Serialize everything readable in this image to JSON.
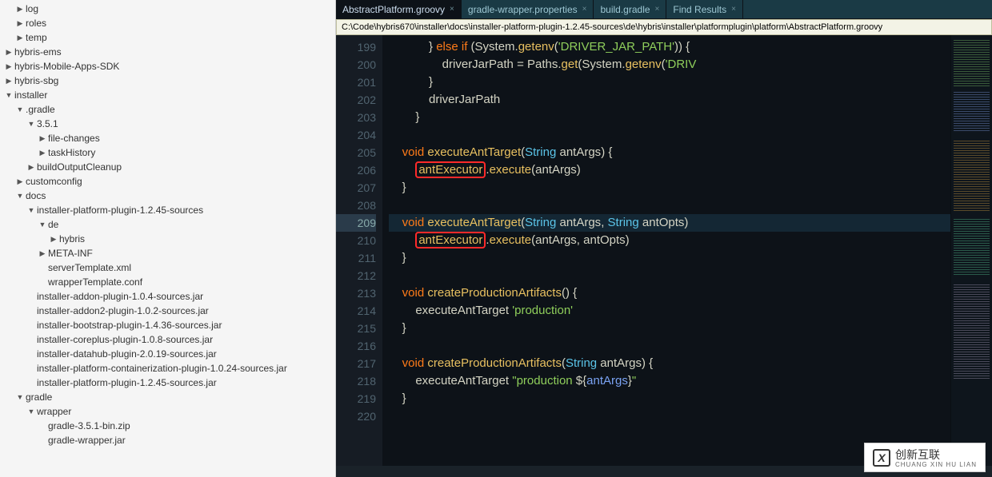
{
  "tree": [
    {
      "label": "log",
      "tw": "▶",
      "ind": 1
    },
    {
      "label": "roles",
      "tw": "▶",
      "ind": 1
    },
    {
      "label": "temp",
      "tw": "▶",
      "ind": 1
    },
    {
      "label": "hybris-ems",
      "tw": "▶",
      "ind": 0
    },
    {
      "label": "hybris-Mobile-Apps-SDK",
      "tw": "▶",
      "ind": 0
    },
    {
      "label": "hybris-sbg",
      "tw": "▶",
      "ind": 0
    },
    {
      "label": "installer",
      "tw": "▼",
      "ind": 0
    },
    {
      "label": ".gradle",
      "tw": "▼",
      "ind": 1
    },
    {
      "label": "3.5.1",
      "tw": "▼",
      "ind": 2
    },
    {
      "label": "file-changes",
      "tw": "▶",
      "ind": 3
    },
    {
      "label": "taskHistory",
      "tw": "▶",
      "ind": 3
    },
    {
      "label": "buildOutputCleanup",
      "tw": "▶",
      "ind": 2
    },
    {
      "label": "customconfig",
      "tw": "▶",
      "ind": 1
    },
    {
      "label": "docs",
      "tw": "▼",
      "ind": 1
    },
    {
      "label": "installer-platform-plugin-1.2.45-sources",
      "tw": "▼",
      "ind": 2
    },
    {
      "label": "de",
      "tw": "▼",
      "ind": 3
    },
    {
      "label": "hybris",
      "tw": "▶",
      "ind": 4
    },
    {
      "label": "META-INF",
      "tw": "▶",
      "ind": 3
    },
    {
      "label": "serverTemplate.xml",
      "tw": "",
      "ind": 3
    },
    {
      "label": "wrapperTemplate.conf",
      "tw": "",
      "ind": 3
    },
    {
      "label": "installer-addon-plugin-1.0.4-sources.jar",
      "tw": "",
      "ind": 2
    },
    {
      "label": "installer-addon2-plugin-1.0.2-sources.jar",
      "tw": "",
      "ind": 2
    },
    {
      "label": "installer-bootstrap-plugin-1.4.36-sources.jar",
      "tw": "",
      "ind": 2
    },
    {
      "label": "installer-coreplus-plugin-1.0.8-sources.jar",
      "tw": "",
      "ind": 2
    },
    {
      "label": "installer-datahub-plugin-2.0.19-sources.jar",
      "tw": "",
      "ind": 2
    },
    {
      "label": "installer-platform-containerization-plugin-1.0.24-sources.jar",
      "tw": "",
      "ind": 2
    },
    {
      "label": "installer-platform-plugin-1.2.45-sources.jar",
      "tw": "",
      "ind": 2
    },
    {
      "label": "gradle",
      "tw": "▼",
      "ind": 1
    },
    {
      "label": "wrapper",
      "tw": "▼",
      "ind": 2
    },
    {
      "label": "gradle-3.5.1-bin.zip",
      "tw": "",
      "ind": 3
    },
    {
      "label": "gradle-wrapper.jar",
      "tw": "",
      "ind": 3
    }
  ],
  "tabs": [
    {
      "label": "AbstractPlatform.groovy",
      "active": true
    },
    {
      "label": "gradle-wrapper.properties",
      "active": false
    },
    {
      "label": "build.gradle",
      "active": false
    },
    {
      "label": "Find Results",
      "active": false
    }
  ],
  "close_glyph": "×",
  "path": "C:\\Code\\hybris670\\installer\\docs\\installer-platform-plugin-1.2.45-sources\\de\\hybris\\installer\\platformplugin\\platform\\AbstractPlatform.groovy",
  "line_start": 199,
  "line_end": 220,
  "highlight_line": 209,
  "code": {
    "199": {
      "segs": [
        [
          "            } ",
          "pun"
        ],
        [
          "else if",
          "kw"
        ],
        [
          " (System.",
          "id"
        ],
        [
          "getenv",
          "fn"
        ],
        [
          "(",
          "pun"
        ],
        [
          "'DRIVER_JAR_PATH'",
          "str"
        ],
        [
          ")) {",
          "pun"
        ]
      ]
    },
    "200": {
      "segs": [
        [
          "                driverJarPath ",
          "id"
        ],
        [
          "=",
          "pun"
        ],
        [
          " Paths.",
          "id"
        ],
        [
          "get",
          "fn"
        ],
        [
          "(System.",
          "id"
        ],
        [
          "getenv",
          "fn"
        ],
        [
          "(",
          "pun"
        ],
        [
          "'DRIV",
          "str"
        ]
      ]
    },
    "201": {
      "segs": [
        [
          "            }",
          "pun"
        ]
      ]
    },
    "202": {
      "segs": [
        [
          "            driverJarPath",
          "id"
        ]
      ]
    },
    "203": {
      "segs": [
        [
          "        }",
          "pun"
        ]
      ]
    },
    "204": {
      "segs": [
        [
          "",
          ""
        ]
      ]
    },
    "205": {
      "segs": [
        [
          "    ",
          "pun"
        ],
        [
          "void",
          "kw"
        ],
        [
          " ",
          "pun"
        ],
        [
          "executeAntTarget",
          "fn"
        ],
        [
          "(",
          "pun"
        ],
        [
          "String",
          "type"
        ],
        [
          " antArgs",
          "id"
        ],
        [
          ") {",
          "pun"
        ]
      ]
    },
    "206": {
      "segs": [
        [
          "        ",
          "pun"
        ],
        [
          "antExecutor",
          "box"
        ],
        [
          ".",
          "pun"
        ],
        [
          "execute",
          "fn"
        ],
        [
          "(antArgs)",
          "id"
        ]
      ]
    },
    "207": {
      "segs": [
        [
          "    }",
          "pun"
        ]
      ]
    },
    "208": {
      "segs": [
        [
          "",
          ""
        ]
      ]
    },
    "209": {
      "segs": [
        [
          "    ",
          "pun"
        ],
        [
          "void",
          "kw"
        ],
        [
          " ",
          "pun"
        ],
        [
          "executeAntTarget",
          "fn"
        ],
        [
          "(",
          "pun"
        ],
        [
          "String",
          "type"
        ],
        [
          " antArgs",
          "id"
        ],
        [
          ", ",
          "pun"
        ],
        [
          "String",
          "type"
        ],
        [
          " antOpts",
          "id"
        ],
        [
          ")",
          "pun"
        ]
      ]
    },
    "210": {
      "segs": [
        [
          "        ",
          "pun"
        ],
        [
          "antExecutor",
          "box"
        ],
        [
          ".",
          "pun"
        ],
        [
          "execute",
          "fn"
        ],
        [
          "(antArgs, antOpts)",
          "id"
        ]
      ]
    },
    "211": {
      "segs": [
        [
          "    }",
          "pun"
        ]
      ]
    },
    "212": {
      "segs": [
        [
          "",
          ""
        ]
      ]
    },
    "213": {
      "segs": [
        [
          "    ",
          "pun"
        ],
        [
          "void",
          "kw"
        ],
        [
          " ",
          "pun"
        ],
        [
          "createProductionArtifacts",
          "fn"
        ],
        [
          "() {",
          "pun"
        ]
      ]
    },
    "214": {
      "segs": [
        [
          "        executeAntTarget ",
          "id"
        ],
        [
          "'production'",
          "str"
        ]
      ]
    },
    "215": {
      "segs": [
        [
          "    }",
          "pun"
        ]
      ]
    },
    "216": {
      "segs": [
        [
          "",
          ""
        ]
      ]
    },
    "217": {
      "segs": [
        [
          "    ",
          "pun"
        ],
        [
          "void",
          "kw"
        ],
        [
          " ",
          "pun"
        ],
        [
          "createProductionArtifacts",
          "fn"
        ],
        [
          "(",
          "pun"
        ],
        [
          "String",
          "type"
        ],
        [
          " antArgs",
          "id"
        ],
        [
          ") {",
          "pun"
        ]
      ]
    },
    "218": {
      "segs": [
        [
          "        executeAntTarget ",
          "id"
        ],
        [
          "\"production ",
          "str"
        ],
        [
          "${",
          "pun"
        ],
        [
          "antArgs",
          "var"
        ],
        [
          "}",
          "pun"
        ],
        [
          "\"",
          "str"
        ]
      ]
    },
    "219": {
      "segs": [
        [
          "    }",
          "pun"
        ]
      ]
    },
    "220": {
      "segs": [
        [
          "",
          ""
        ]
      ]
    }
  },
  "watermark": {
    "logo": "X",
    "brand": "创新互联",
    "sub": "CHUANG XIN HU LIAN"
  }
}
